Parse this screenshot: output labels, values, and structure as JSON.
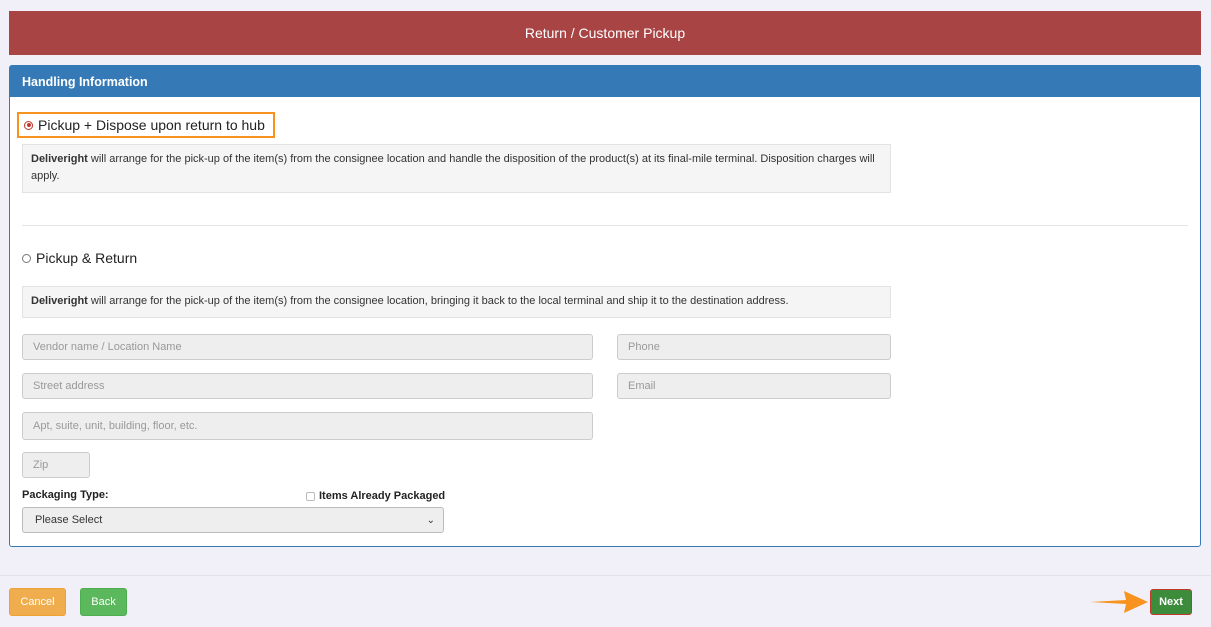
{
  "header": {
    "title": "Return / Customer Pickup"
  },
  "panel": {
    "heading": "Handling Information",
    "options": [
      {
        "label": "Pickup + Dispose upon return to hub",
        "selected": true,
        "desc_brand": "Deliveright",
        "desc_text": " will arrange for the pick-up of the item(s) from the consignee location and handle the disposition of the product(s) at its final-mile terminal. Disposition charges will apply."
      },
      {
        "label": "Pickup & Return",
        "selected": false,
        "desc_brand": "Deliveright",
        "desc_text": " will arrange for the pick-up of the item(s) from the consignee location, bringing it back to the local terminal and ship it to the destination address."
      }
    ]
  },
  "form": {
    "vendor_placeholder": "Vendor name / Location Name",
    "phone_placeholder": "Phone",
    "street_placeholder": "Street address",
    "email_placeholder": "Email",
    "apt_placeholder": "Apt, suite, unit, building, floor, etc.",
    "zip_placeholder": "Zip",
    "packaging_label": "Packaging Type:",
    "items_packaged_label": "Items Already Packaged",
    "items_packaged_checked": false,
    "packaging_select_value": "Please Select"
  },
  "footer": {
    "cancel_label": "Cancel",
    "back_label": "Back",
    "next_label": "Next"
  },
  "colors": {
    "header_bg": "#a84444",
    "panel_accent": "#357ab7",
    "highlight_outline": "#f7931e",
    "cancel_bg": "#f0ad4e",
    "back_bg": "#5cb85c",
    "next_bg": "#3c8c3c"
  }
}
